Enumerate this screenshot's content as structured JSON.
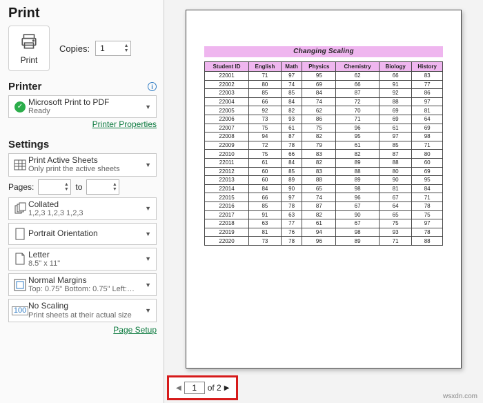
{
  "title": "Print",
  "print_button": "Print",
  "copies": {
    "label": "Copies:",
    "value": "1"
  },
  "printer_section": {
    "label": "Printer",
    "device_l1": "Microsoft Print to PDF",
    "device_l2": "Ready",
    "props": "Printer Properties"
  },
  "settings_section": {
    "label": "Settings",
    "active_sheets_l1": "Print Active Sheets",
    "active_sheets_l2": "Only print the active sheets",
    "pages_label": "Pages:",
    "pages_to": "to",
    "collated_l1": "Collated",
    "collated_l2": "1,2,3   1,2,3   1,2,3",
    "orientation": "Portrait Orientation",
    "paper_l1": "Letter",
    "paper_l2": "8.5\" x 11\"",
    "margins_l1": "Normal Margins",
    "margins_l2": "Top: 0.75\" Bottom: 0.75\" Left:…",
    "scaling_l1": "No Scaling",
    "scaling_l2": "Print sheets at their actual size",
    "page_setup": "Page Setup"
  },
  "pager": {
    "page": "1",
    "of": "of 2"
  },
  "watermark": "wsxdn.com",
  "chart_data": {
    "type": "table",
    "title": "Changing Scaling",
    "headers": [
      "Student ID",
      "English",
      "Math",
      "Physics",
      "Chemistry",
      "Biology",
      "History"
    ],
    "rows": [
      [
        22001,
        71,
        97,
        95,
        62,
        66,
        83
      ],
      [
        22002,
        80,
        74,
        69,
        66,
        91,
        77
      ],
      [
        22003,
        85,
        85,
        84,
        87,
        92,
        86
      ],
      [
        22004,
        66,
        84,
        74,
        72,
        88,
        97
      ],
      [
        22005,
        92,
        82,
        62,
        70,
        69,
        81
      ],
      [
        22006,
        73,
        93,
        86,
        71,
        69,
        64
      ],
      [
        22007,
        75,
        61,
        75,
        96,
        61,
        69
      ],
      [
        22008,
        94,
        87,
        82,
        95,
        97,
        98
      ],
      [
        22009,
        72,
        78,
        79,
        61,
        85,
        71
      ],
      [
        22010,
        75,
        66,
        83,
        82,
        87,
        80
      ],
      [
        22011,
        61,
        84,
        82,
        89,
        88,
        60
      ],
      [
        22012,
        60,
        85,
        83,
        88,
        80,
        69
      ],
      [
        22013,
        60,
        89,
        88,
        89,
        90,
        95
      ],
      [
        22014,
        84,
        90,
        65,
        98,
        81,
        84
      ],
      [
        22015,
        66,
        97,
        74,
        96,
        67,
        71
      ],
      [
        22016,
        85,
        78,
        87,
        67,
        64,
        78
      ],
      [
        22017,
        91,
        63,
        82,
        90,
        65,
        75
      ],
      [
        22018,
        63,
        77,
        61,
        67,
        75,
        97
      ],
      [
        22019,
        81,
        76,
        94,
        98,
        93,
        78
      ],
      [
        22020,
        73,
        78,
        96,
        89,
        71,
        88
      ]
    ]
  }
}
